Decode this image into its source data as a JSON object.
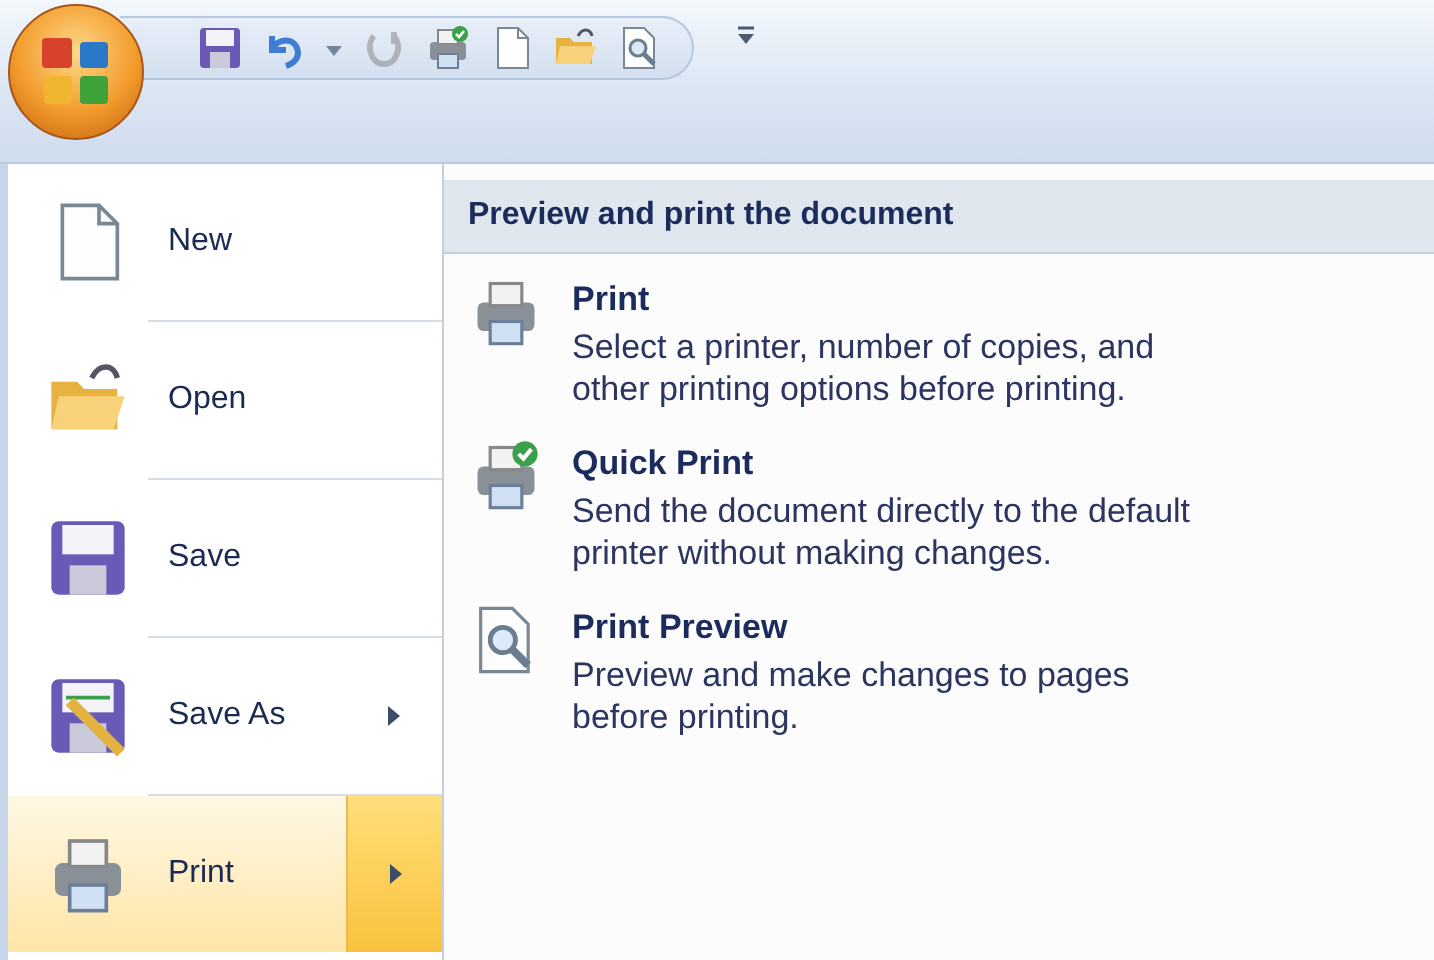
{
  "quick_access_toolbar": [
    {
      "kind": "save",
      "disabled": false
    },
    {
      "kind": "undo",
      "disabled": false
    },
    {
      "kind": "dropdown",
      "disabled": false
    },
    {
      "kind": "redo",
      "disabled": true
    },
    {
      "kind": "quick-print",
      "disabled": false
    },
    {
      "kind": "new",
      "disabled": false
    },
    {
      "kind": "open",
      "disabled": false
    },
    {
      "kind": "preview",
      "disabled": false
    },
    {
      "kind": "customize",
      "disabled": false
    }
  ],
  "office_menu": {
    "items": [
      {
        "kind": "new",
        "label": "New",
        "selected": false,
        "submenu": false
      },
      {
        "kind": "open",
        "label": "Open",
        "selected": false,
        "submenu": false
      },
      {
        "kind": "save",
        "label": "Save",
        "selected": false,
        "submenu": false
      },
      {
        "kind": "save-as",
        "label": "Save As",
        "selected": false,
        "submenu": true
      },
      {
        "kind": "print",
        "label": "Print",
        "selected": true,
        "submenu": true
      }
    ],
    "submenu": {
      "title": "Preview and print the document",
      "items": [
        {
          "kind": "print",
          "label": "Print",
          "description": "Select a printer, number of copies, and other printing options before printing."
        },
        {
          "kind": "quick-print",
          "label": "Quick Print",
          "description": "Send the document directly to the default printer without making changes."
        },
        {
          "kind": "preview",
          "label": "Print Preview",
          "description": "Preview and make changes to pages before printing."
        }
      ]
    }
  }
}
